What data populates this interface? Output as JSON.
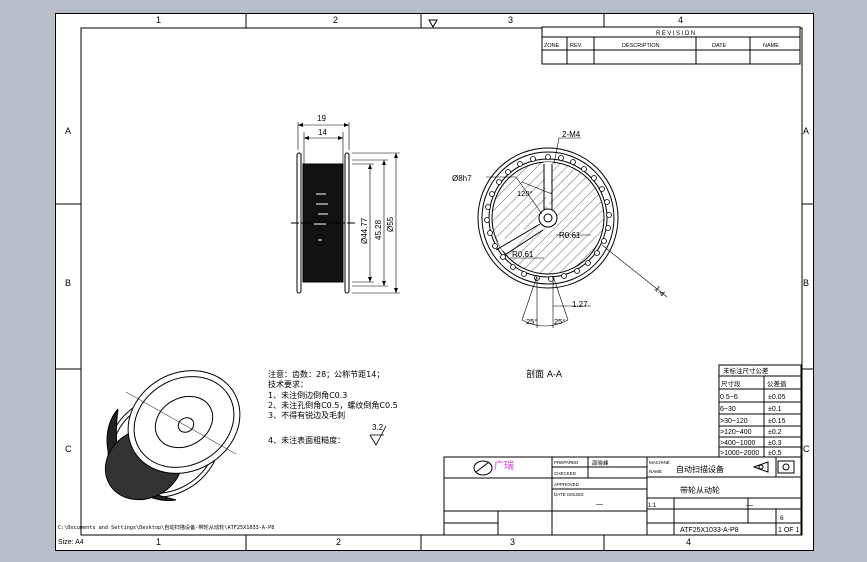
{
  "zones": {
    "top": [
      "1",
      "2",
      "3",
      "4"
    ],
    "bottom": [
      "1",
      "2",
      "3",
      "4"
    ],
    "left": [
      "A",
      "B",
      "C"
    ],
    "right": [
      "A",
      "B",
      "C"
    ]
  },
  "revision": {
    "title": "REVISION",
    "headers": [
      "ZONE",
      "REV.",
      "DESCRIPTION",
      "DATE",
      "NAME"
    ]
  },
  "dims": {
    "d19": "19",
    "d14": "14",
    "d4477": "Ø44.77",
    "d4528": "45.28",
    "d55": "Ø55",
    "m4": "2-M4",
    "d8h7": "Ø8h7",
    "a120": "120°",
    "r061a": "R0.61",
    "r061b": "R0.61",
    "d127": "1.27",
    "a25l": "25°",
    "a25r": "25°",
    "v14": "1.4"
  },
  "section_label": "剖面 A-A",
  "notes": {
    "line1": "注意：齿数：28；公称节距14；",
    "line2": "技术要求：",
    "items": [
      "1、未注倒边倒角C0.3",
      "2、未注孔倒角C0.5，螺纹倒角C0.5",
      "3、不得有锐边及毛刺",
      "4、未注表面粗糙度："
    ],
    "roughness": "3.2"
  },
  "tolerance": {
    "title": "未标注尺寸公差",
    "headers": [
      "尺寸段",
      "公差值"
    ],
    "rows": [
      [
        "0.5~6",
        "±0.05"
      ],
      [
        "6~30",
        "±0.1"
      ],
      [
        ">30~120",
        "±0.15"
      ],
      [
        ">120~400",
        "±0.2"
      ],
      [
        ">400~1000",
        "±0.3"
      ],
      [
        ">1000~2000",
        "±0.5"
      ]
    ]
  },
  "title_block": {
    "logo_text": "广瑞",
    "prepared": "PREPARED",
    "checked": "CHECKED",
    "approved": "APPROVED",
    "date_issued": "DATE ISSUED",
    "designer": "邵晓峰",
    "project": "自动扫描设备",
    "part_name": "带轮从动轮",
    "drawing_no": "ATF25X1033-A-P8",
    "sheet": "1 OF 1",
    "scale": "1:1",
    "sheet_no": "6",
    "dash1": "—",
    "dash2": "—",
    "machine_label": "MACHINE",
    "name_label": "NAME"
  },
  "file_path": "C:\\Documents and Settings\\Desktop\\自动扫描设备-带轮从动轮\\ATF25X1033-A-P8",
  "size_label": "Size: A4"
}
